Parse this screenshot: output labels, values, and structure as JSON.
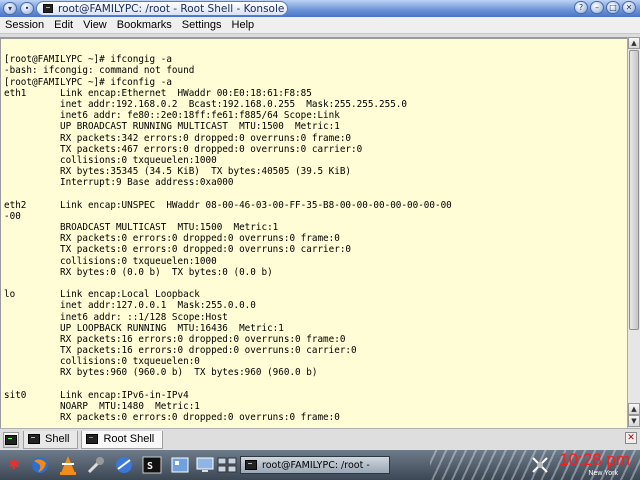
{
  "window": {
    "title": "root@FAMILYPC: /root - Root Shell - Konsole"
  },
  "menubar": [
    "Session",
    "Edit",
    "View",
    "Bookmarks",
    "Settings",
    "Help"
  ],
  "terminal": {
    "lines": [
      "",
      "[root@FAMILYPC ~]# ifcongig -a",
      "-bash: ifcongig: command not found",
      "[root@FAMILYPC ~]# ifconfig -a",
      "eth1      Link encap:Ethernet  HWaddr 00:E0:18:61:F8:85",
      "          inet addr:192.168.0.2  Bcast:192.168.0.255  Mask:255.255.255.0",
      "          inet6 addr: fe80::2e0:18ff:fe61:f885/64 Scope:Link",
      "          UP BROADCAST RUNNING MULTICAST  MTU:1500  Metric:1",
      "          RX packets:342 errors:0 dropped:0 overruns:0 frame:0",
      "          TX packets:467 errors:0 dropped:0 overruns:0 carrier:0",
      "          collisions:0 txqueuelen:1000",
      "          RX bytes:35345 (34.5 KiB)  TX bytes:40505 (39.5 KiB)",
      "          Interrupt:9 Base address:0xa000",
      "",
      "eth2      Link encap:UNSPEC  HWaddr 08-00-46-03-00-FF-35-B8-00-00-00-00-00-00-00",
      "-00",
      "          BROADCAST MULTICAST  MTU:1500  Metric:1",
      "          RX packets:0 errors:0 dropped:0 overruns:0 frame:0",
      "          TX packets:0 errors:0 dropped:0 overruns:0 carrier:0",
      "          collisions:0 txqueuelen:1000",
      "          RX bytes:0 (0.0 b)  TX bytes:0 (0.0 b)",
      "",
      "lo        Link encap:Local Loopback",
      "          inet addr:127.0.0.1  Mask:255.0.0.0",
      "          inet6 addr: ::1/128 Scope:Host",
      "          UP LOOPBACK RUNNING  MTU:16436  Metric:1",
      "          RX packets:16 errors:0 dropped:0 overruns:0 frame:0",
      "          TX packets:16 errors:0 dropped:0 overruns:0 carrier:0",
      "          collisions:0 txqueuelen:0",
      "          RX bytes:960 (960.0 b)  TX bytes:960 (960.0 b)",
      "",
      "sit0      Link encap:IPv6-in-IPv4",
      "          NOARP  MTU:1480  Metric:1",
      "          RX packets:0 errors:0 dropped:0 overruns:0 frame:0"
    ]
  },
  "tabs": [
    {
      "label": "Shell",
      "icon": "terminal-icon",
      "active": false
    },
    {
      "label": "Root Shell",
      "icon": "root-terminal-icon",
      "active": true
    }
  ],
  "taskbar": {
    "task_label": "root@FAMILYPC: /root -",
    "clock_time": "10:28 pm",
    "clock_location": "New York",
    "launchers": [
      "kde-menu-icon",
      "firefox-icon",
      "vlc-icon",
      "tools-icon",
      "browser-icon",
      "terminal-icon",
      "apps-icon",
      "desktop-icon",
      "pager-icon"
    ]
  },
  "colors": {
    "terminal_background": "#fffdd6",
    "clock": "#ff1a1a",
    "title_gradient": "#6f97d8"
  }
}
